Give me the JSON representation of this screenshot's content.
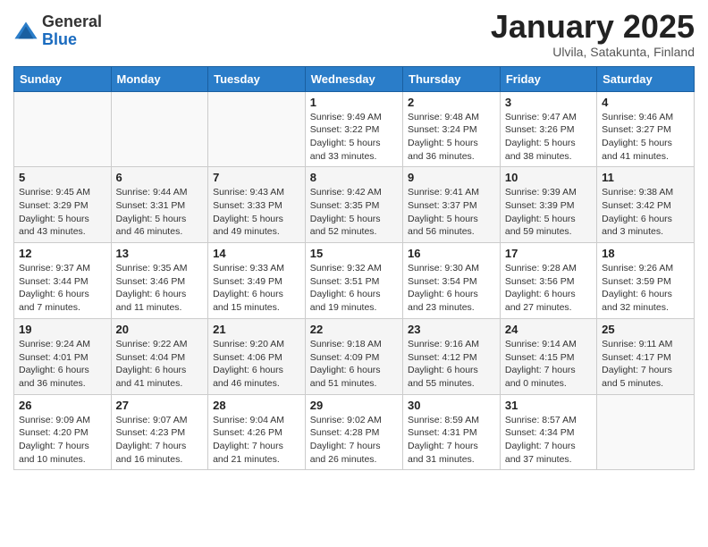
{
  "logo": {
    "general": "General",
    "blue": "Blue"
  },
  "title": "January 2025",
  "subtitle": "Ulvila, Satakunta, Finland",
  "headers": [
    "Sunday",
    "Monday",
    "Tuesday",
    "Wednesday",
    "Thursday",
    "Friday",
    "Saturday"
  ],
  "weeks": [
    [
      {
        "day": "",
        "sunrise": "",
        "sunset": "",
        "daylight": ""
      },
      {
        "day": "",
        "sunrise": "",
        "sunset": "",
        "daylight": ""
      },
      {
        "day": "",
        "sunrise": "",
        "sunset": "",
        "daylight": ""
      },
      {
        "day": "1",
        "sunrise": "Sunrise: 9:49 AM",
        "sunset": "Sunset: 3:22 PM",
        "daylight": "Daylight: 5 hours and 33 minutes."
      },
      {
        "day": "2",
        "sunrise": "Sunrise: 9:48 AM",
        "sunset": "Sunset: 3:24 PM",
        "daylight": "Daylight: 5 hours and 36 minutes."
      },
      {
        "day": "3",
        "sunrise": "Sunrise: 9:47 AM",
        "sunset": "Sunset: 3:26 PM",
        "daylight": "Daylight: 5 hours and 38 minutes."
      },
      {
        "day": "4",
        "sunrise": "Sunrise: 9:46 AM",
        "sunset": "Sunset: 3:27 PM",
        "daylight": "Daylight: 5 hours and 41 minutes."
      }
    ],
    [
      {
        "day": "5",
        "sunrise": "Sunrise: 9:45 AM",
        "sunset": "Sunset: 3:29 PM",
        "daylight": "Daylight: 5 hours and 43 minutes."
      },
      {
        "day": "6",
        "sunrise": "Sunrise: 9:44 AM",
        "sunset": "Sunset: 3:31 PM",
        "daylight": "Daylight: 5 hours and 46 minutes."
      },
      {
        "day": "7",
        "sunrise": "Sunrise: 9:43 AM",
        "sunset": "Sunset: 3:33 PM",
        "daylight": "Daylight: 5 hours and 49 minutes."
      },
      {
        "day": "8",
        "sunrise": "Sunrise: 9:42 AM",
        "sunset": "Sunset: 3:35 PM",
        "daylight": "Daylight: 5 hours and 52 minutes."
      },
      {
        "day": "9",
        "sunrise": "Sunrise: 9:41 AM",
        "sunset": "Sunset: 3:37 PM",
        "daylight": "Daylight: 5 hours and 56 minutes."
      },
      {
        "day": "10",
        "sunrise": "Sunrise: 9:39 AM",
        "sunset": "Sunset: 3:39 PM",
        "daylight": "Daylight: 5 hours and 59 minutes."
      },
      {
        "day": "11",
        "sunrise": "Sunrise: 9:38 AM",
        "sunset": "Sunset: 3:42 PM",
        "daylight": "Daylight: 6 hours and 3 minutes."
      }
    ],
    [
      {
        "day": "12",
        "sunrise": "Sunrise: 9:37 AM",
        "sunset": "Sunset: 3:44 PM",
        "daylight": "Daylight: 6 hours and 7 minutes."
      },
      {
        "day": "13",
        "sunrise": "Sunrise: 9:35 AM",
        "sunset": "Sunset: 3:46 PM",
        "daylight": "Daylight: 6 hours and 11 minutes."
      },
      {
        "day": "14",
        "sunrise": "Sunrise: 9:33 AM",
        "sunset": "Sunset: 3:49 PM",
        "daylight": "Daylight: 6 hours and 15 minutes."
      },
      {
        "day": "15",
        "sunrise": "Sunrise: 9:32 AM",
        "sunset": "Sunset: 3:51 PM",
        "daylight": "Daylight: 6 hours and 19 minutes."
      },
      {
        "day": "16",
        "sunrise": "Sunrise: 9:30 AM",
        "sunset": "Sunset: 3:54 PM",
        "daylight": "Daylight: 6 hours and 23 minutes."
      },
      {
        "day": "17",
        "sunrise": "Sunrise: 9:28 AM",
        "sunset": "Sunset: 3:56 PM",
        "daylight": "Daylight: 6 hours and 27 minutes."
      },
      {
        "day": "18",
        "sunrise": "Sunrise: 9:26 AM",
        "sunset": "Sunset: 3:59 PM",
        "daylight": "Daylight: 6 hours and 32 minutes."
      }
    ],
    [
      {
        "day": "19",
        "sunrise": "Sunrise: 9:24 AM",
        "sunset": "Sunset: 4:01 PM",
        "daylight": "Daylight: 6 hours and 36 minutes."
      },
      {
        "day": "20",
        "sunrise": "Sunrise: 9:22 AM",
        "sunset": "Sunset: 4:04 PM",
        "daylight": "Daylight: 6 hours and 41 minutes."
      },
      {
        "day": "21",
        "sunrise": "Sunrise: 9:20 AM",
        "sunset": "Sunset: 4:06 PM",
        "daylight": "Daylight: 6 hours and 46 minutes."
      },
      {
        "day": "22",
        "sunrise": "Sunrise: 9:18 AM",
        "sunset": "Sunset: 4:09 PM",
        "daylight": "Daylight: 6 hours and 51 minutes."
      },
      {
        "day": "23",
        "sunrise": "Sunrise: 9:16 AM",
        "sunset": "Sunset: 4:12 PM",
        "daylight": "Daylight: 6 hours and 55 minutes."
      },
      {
        "day": "24",
        "sunrise": "Sunrise: 9:14 AM",
        "sunset": "Sunset: 4:15 PM",
        "daylight": "Daylight: 7 hours and 0 minutes."
      },
      {
        "day": "25",
        "sunrise": "Sunrise: 9:11 AM",
        "sunset": "Sunset: 4:17 PM",
        "daylight": "Daylight: 7 hours and 5 minutes."
      }
    ],
    [
      {
        "day": "26",
        "sunrise": "Sunrise: 9:09 AM",
        "sunset": "Sunset: 4:20 PM",
        "daylight": "Daylight: 7 hours and 10 minutes."
      },
      {
        "day": "27",
        "sunrise": "Sunrise: 9:07 AM",
        "sunset": "Sunset: 4:23 PM",
        "daylight": "Daylight: 7 hours and 16 minutes."
      },
      {
        "day": "28",
        "sunrise": "Sunrise: 9:04 AM",
        "sunset": "Sunset: 4:26 PM",
        "daylight": "Daylight: 7 hours and 21 minutes."
      },
      {
        "day": "29",
        "sunrise": "Sunrise: 9:02 AM",
        "sunset": "Sunset: 4:28 PM",
        "daylight": "Daylight: 7 hours and 26 minutes."
      },
      {
        "day": "30",
        "sunrise": "Sunrise: 8:59 AM",
        "sunset": "Sunset: 4:31 PM",
        "daylight": "Daylight: 7 hours and 31 minutes."
      },
      {
        "day": "31",
        "sunrise": "Sunrise: 8:57 AM",
        "sunset": "Sunset: 4:34 PM",
        "daylight": "Daylight: 7 hours and 37 minutes."
      },
      {
        "day": "",
        "sunrise": "",
        "sunset": "",
        "daylight": ""
      }
    ]
  ]
}
